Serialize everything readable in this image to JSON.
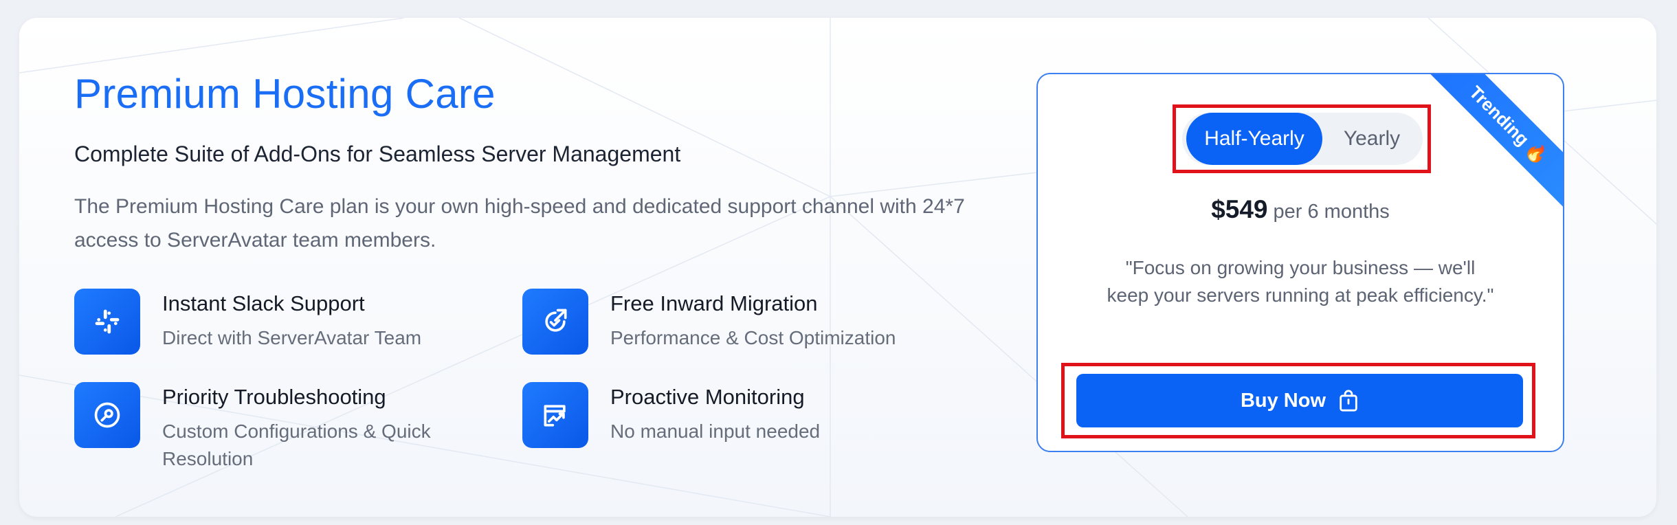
{
  "header": {
    "title": "Premium Hosting Care",
    "subtitle": "Complete Suite of Add-Ons for Seamless Server Management",
    "description": "The Premium Hosting Care plan is your own high-speed and dedicated support channel with 24*7 access to ServerAvatar team members."
  },
  "features": [
    {
      "icon": "slack-icon",
      "title": "Instant Slack Support",
      "subtitle": "Direct with ServerAvatar Team"
    },
    {
      "icon": "migration-icon",
      "title": "Free Inward Migration",
      "subtitle": "Performance & Cost Optimization"
    },
    {
      "icon": "wrench-icon",
      "title": "Priority Troubleshooting",
      "subtitle": "Custom Configurations & Quick Resolution"
    },
    {
      "icon": "monitoring-chart-icon",
      "title": "Proactive Monitoring",
      "subtitle": "No manual input needed"
    }
  ],
  "plan": {
    "ribbon": "Trending",
    "ribbon_icon": "fire-icon",
    "toggle": {
      "options": [
        "Half-Yearly",
        "Yearly"
      ],
      "selected": "Half-Yearly"
    },
    "price": "$549",
    "period": "per 6 months",
    "quote": "\"Focus on growing your business — we'll keep your servers running at peak efficiency.\"",
    "buy_label": "Buy Now",
    "buy_icon": "shopping-bag-icon"
  },
  "colors": {
    "accent": "#0b63f6",
    "title": "#1a6df5",
    "highlight": "#e1131a",
    "background": "#eef1f6"
  }
}
